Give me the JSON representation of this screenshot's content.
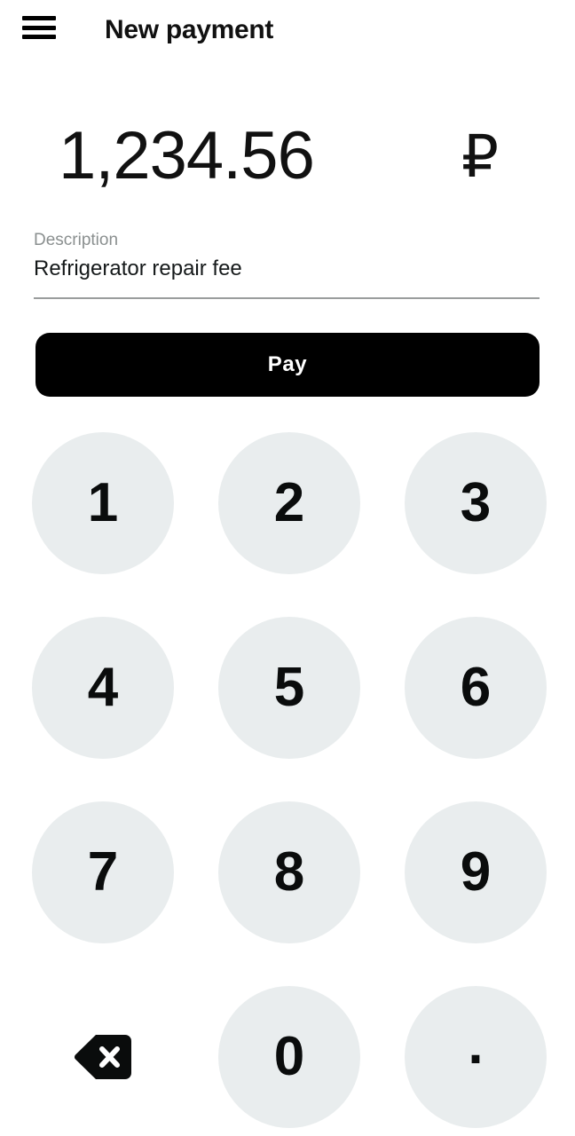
{
  "header": {
    "menu_icon": "hamburger-menu-icon",
    "title": "New payment"
  },
  "amount": {
    "value": "1,234.56",
    "currency_symbol": "₽",
    "currency_name": "russian-ruble"
  },
  "description": {
    "label": "Description",
    "value": "Refrigerator repair fee",
    "placeholder": "Description"
  },
  "actions": {
    "pay_label": "Pay"
  },
  "keypad": {
    "keys": [
      {
        "label": "1",
        "name": "key-1",
        "type": "digit"
      },
      {
        "label": "2",
        "name": "key-2",
        "type": "digit"
      },
      {
        "label": "3",
        "name": "key-3",
        "type": "digit"
      },
      {
        "label": "4",
        "name": "key-4",
        "type": "digit"
      },
      {
        "label": "5",
        "name": "key-5",
        "type": "digit"
      },
      {
        "label": "6",
        "name": "key-6",
        "type": "digit"
      },
      {
        "label": "7",
        "name": "key-7",
        "type": "digit"
      },
      {
        "label": "8",
        "name": "key-8",
        "type": "digit"
      },
      {
        "label": "9",
        "name": "key-9",
        "type": "digit"
      },
      {
        "label": "",
        "name": "key-backspace",
        "type": "backspace"
      },
      {
        "label": "0",
        "name": "key-0",
        "type": "digit"
      },
      {
        "label": ".",
        "name": "key-decimal",
        "type": "decimal"
      }
    ]
  },
  "colors": {
    "background": "#ffffff",
    "text_primary": "#111111",
    "text_muted": "#8a8f8f",
    "key_background": "#e9edee",
    "button_primary": "#000000",
    "button_primary_text": "#ffffff",
    "divider": "#9a9d9d"
  }
}
